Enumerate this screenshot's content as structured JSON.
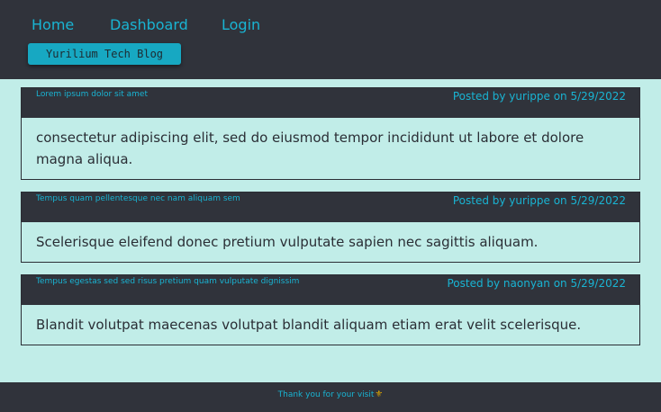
{
  "nav": {
    "home": "Home",
    "dashboard": "Dashboard",
    "login": "Login"
  },
  "brand": "Yurilium Tech Blog",
  "posts": [
    {
      "title": "Lorem ipsum dolor sit amet",
      "meta": "Posted by yurippe on 5/29/2022",
      "body": "consectetur adipiscing elit, sed do eiusmod tempor incididunt ut labore et dolore magna aliqua."
    },
    {
      "title": "Tempus quam pellentesque nec nam aliquam sem",
      "meta": "Posted by yurippe on 5/29/2022",
      "body": "Scelerisque eleifend donec pretium vulputate sapien nec sagittis aliquam."
    },
    {
      "title": "Tempus egestas sed sed risus pretium quam vulputate dignissim",
      "meta": "Posted by naonyan on 5/29/2022",
      "body": "Blandit volutpat maecenas volutpat blandit aliquam etiam erat velit scelerisque."
    }
  ],
  "footer": {
    "text": "Thank you for your visit",
    "icon": "fleur-de-lis-icon",
    "icon_glyph": "⚜"
  },
  "colors": {
    "accent": "#19b4d3",
    "header_bg": "#30333b",
    "page_bg": "#c1ede8",
    "brand_bg": "#17a8c2"
  }
}
